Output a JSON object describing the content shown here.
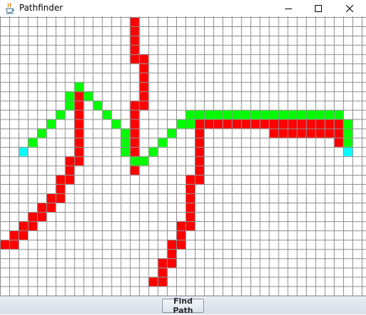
{
  "window": {
    "title": "Pathfinder",
    "icon": "java-cup-icon",
    "controls": [
      "minimize-icon",
      "maximize-icon",
      "close-icon"
    ]
  },
  "grid": {
    "cols": 39,
    "rows": 30,
    "colors": {
      "background": "#ffffff",
      "line": "#8c8c8c",
      "wall": "#ff0000",
      "path": "#00ff00",
      "endpoint": "#00ffff"
    },
    "walls": [
      [
        14,
        0
      ],
      [
        14,
        1
      ],
      [
        14,
        2
      ],
      [
        14,
        3
      ],
      [
        14,
        4
      ],
      [
        15,
        4
      ],
      [
        15,
        5
      ],
      [
        15,
        6
      ],
      [
        15,
        7
      ],
      [
        15,
        8
      ],
      [
        15,
        9
      ],
      [
        14,
        9
      ],
      [
        14,
        10
      ],
      [
        14,
        11
      ],
      [
        14,
        12
      ],
      [
        14,
        13
      ],
      [
        14,
        14
      ],
      [
        14,
        15
      ],
      [
        14,
        16
      ],
      [
        8,
        8
      ],
      [
        8,
        9
      ],
      [
        8,
        10
      ],
      [
        8,
        11
      ],
      [
        8,
        12
      ],
      [
        8,
        13
      ],
      [
        8,
        14
      ],
      [
        8,
        15
      ],
      [
        7,
        15
      ],
      [
        7,
        16
      ],
      [
        7,
        17
      ],
      [
        6,
        17
      ],
      [
        6,
        18
      ],
      [
        6,
        19
      ],
      [
        5,
        19
      ],
      [
        5,
        20
      ],
      [
        4,
        20
      ],
      [
        4,
        21
      ],
      [
        3,
        21
      ],
      [
        3,
        22
      ],
      [
        2,
        22
      ],
      [
        2,
        23
      ],
      [
        1,
        23
      ],
      [
        0,
        24
      ],
      [
        1,
        24
      ],
      [
        21,
        11
      ],
      [
        22,
        11
      ],
      [
        23,
        11
      ],
      [
        24,
        11
      ],
      [
        25,
        11
      ],
      [
        26,
        11
      ],
      [
        27,
        11
      ],
      [
        28,
        11
      ],
      [
        29,
        11
      ],
      [
        30,
        11
      ],
      [
        31,
        11
      ],
      [
        32,
        11
      ],
      [
        33,
        11
      ],
      [
        34,
        11
      ],
      [
        35,
        11
      ],
      [
        36,
        11
      ],
      [
        29,
        12
      ],
      [
        30,
        12
      ],
      [
        31,
        12
      ],
      [
        32,
        12
      ],
      [
        33,
        12
      ],
      [
        34,
        12
      ],
      [
        35,
        12
      ],
      [
        36,
        12
      ],
      [
        36,
        13
      ],
      [
        21,
        12
      ],
      [
        21,
        13
      ],
      [
        21,
        14
      ],
      [
        21,
        15
      ],
      [
        21,
        16
      ],
      [
        21,
        17
      ],
      [
        20,
        17
      ],
      [
        20,
        18
      ],
      [
        20,
        19
      ],
      [
        20,
        20
      ],
      [
        20,
        21
      ],
      [
        20,
        22
      ],
      [
        19,
        22
      ],
      [
        19,
        23
      ],
      [
        19,
        24
      ],
      [
        18,
        24
      ],
      [
        18,
        25
      ],
      [
        18,
        26
      ],
      [
        17,
        26
      ],
      [
        17,
        27
      ],
      [
        17,
        28
      ],
      [
        16,
        28
      ]
    ],
    "path": [
      [
        8,
        7
      ],
      [
        7,
        8
      ],
      [
        9,
        8
      ],
      [
        7,
        9
      ],
      [
        10,
        9
      ],
      [
        6,
        10
      ],
      [
        11,
        10
      ],
      [
        5,
        11
      ],
      [
        12,
        11
      ],
      [
        4,
        12
      ],
      [
        13,
        12
      ],
      [
        3,
        13
      ],
      [
        13,
        13
      ],
      [
        13,
        14
      ],
      [
        14,
        15
      ],
      [
        15,
        15
      ],
      [
        16,
        14
      ],
      [
        17,
        13
      ],
      [
        18,
        12
      ],
      [
        19,
        11
      ],
      [
        20,
        11
      ],
      [
        20,
        10
      ],
      [
        21,
        10
      ],
      [
        22,
        10
      ],
      [
        23,
        10
      ],
      [
        24,
        10
      ],
      [
        25,
        10
      ],
      [
        26,
        10
      ],
      [
        27,
        10
      ],
      [
        28,
        10
      ],
      [
        29,
        10
      ],
      [
        30,
        10
      ],
      [
        31,
        10
      ],
      [
        32,
        10
      ],
      [
        33,
        10
      ],
      [
        34,
        10
      ],
      [
        35,
        10
      ],
      [
        36,
        10
      ],
      [
        37,
        11
      ],
      [
        37,
        12
      ],
      [
        37,
        13
      ]
    ],
    "endpoints": [
      [
        2,
        14
      ],
      [
        37,
        14
      ]
    ]
  },
  "controls": {
    "find_path_label": "Find Path"
  }
}
